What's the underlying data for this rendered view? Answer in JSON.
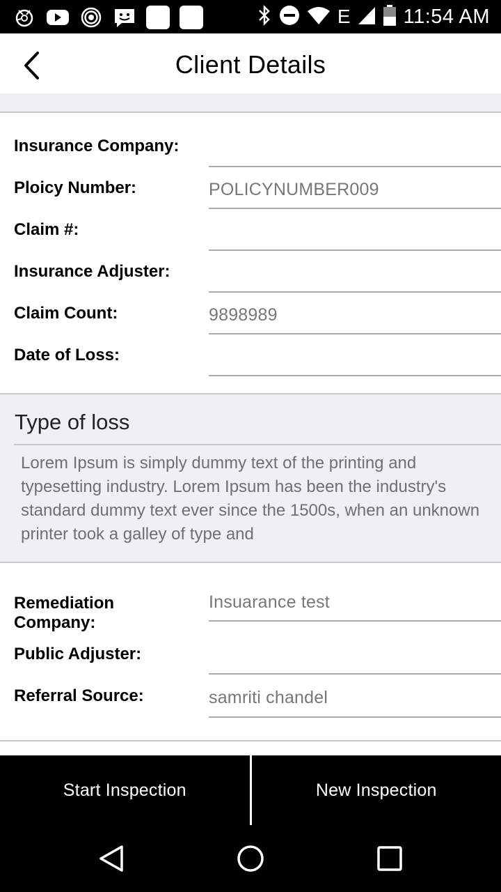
{
  "status_bar": {
    "time": "11:54 AM",
    "network": "E",
    "left_icons": [
      "camera-shutter-icon",
      "youtube-icon",
      "signal-rings-icon",
      "message-face-icon",
      "app-square-icon",
      "app-square-icon"
    ],
    "right_icons": [
      "bluetooth-icon",
      "do-not-disturb-icon",
      "wifi-icon",
      "cell-signal-icon",
      "battery-icon"
    ]
  },
  "header": {
    "title": "Client Details",
    "back_icon": "chevron-left-icon"
  },
  "insurance_fields": [
    {
      "label": "Insurance Company:",
      "value": ""
    },
    {
      "label": "Ploicy Number:",
      "value": "POLICYNUMBER009"
    },
    {
      "label": "Claim #:",
      "value": ""
    },
    {
      "label": "Insurance Adjuster:",
      "value": ""
    },
    {
      "label": "Claim Count:",
      "value": "9898989"
    },
    {
      "label": "Date of Loss:",
      "value": ""
    }
  ],
  "type_of_loss": {
    "title": "Type of loss",
    "text": "Lorem Ipsum is simply dummy text of the printing and typesetting industry. Lorem Ipsum has been the industry's standard dummy text ever since the 1500s, when an unknown printer took a galley of type and"
  },
  "other_fields": [
    {
      "label": "Remediation Company:",
      "value": "Insuarance test"
    },
    {
      "label": "Public Adjuster:",
      "value": ""
    },
    {
      "label": "Referral Source:",
      "value": "samriti chandel"
    }
  ],
  "actions": {
    "start_label": "Start Inspection",
    "new_label": "New Inspection"
  },
  "nav": {
    "icons": [
      "back-triangle-icon",
      "home-circle-icon",
      "recents-square-icon"
    ]
  },
  "colors": {
    "section_bg": "#efeff4",
    "divider": "#c8c8c8",
    "value_text": "#777777",
    "bar_bg": "#000000"
  }
}
